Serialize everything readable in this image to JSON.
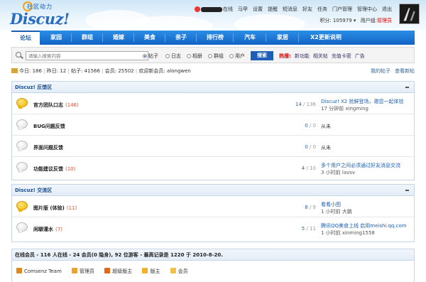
{
  "header": {
    "logo_sub": "社区动力",
    "logo_main": "Discuz!",
    "top_links": [
      "在线",
      "马甲",
      "设置",
      "提醒",
      "短消息",
      "好友",
      "任务",
      "门户管理",
      "管理中心",
      "退出"
    ],
    "points_label": "积分: 105979",
    "group_label": "用户组:",
    "group_value": "管理员"
  },
  "nav": {
    "items": [
      "论坛",
      "家园",
      "群组",
      "婚嫁",
      "美食",
      "亲子",
      "排行榜",
      "汽车",
      "家居",
      "X2更新说明"
    ],
    "active_index": 0
  },
  "search": {
    "placeholder": "请输入搜索内容",
    "options": [
      "帖子",
      "日志",
      "相册",
      "群组",
      "用户"
    ],
    "selected_index": 0,
    "button_label": "搜索",
    "hot_label": "热搜:",
    "hot_items": [
      "新功能",
      "相关帖",
      "充值卡密",
      "广告"
    ]
  },
  "stats": {
    "today": "今日: 186",
    "yesterday": "昨日: 12",
    "posts": "帖子: 41566",
    "members": "会员: 25502",
    "welcome": "欢迎新会员: alongwen",
    "my_posts": "我的帖子",
    "new_posts": "查看新帖"
  },
  "categories": [
    {
      "title": "Discuz! 反馈区",
      "forums": [
        {
          "name": "官方团队口志",
          "count": "(146)",
          "new": true,
          "threads": "14",
          "posts": "136",
          "last_title": "Discuz! X2 抢鲜登场，邀您一起体验",
          "last_meta": "17 分钟前 xingming"
        },
        {
          "name": "BUG问题反馈",
          "count": "",
          "new": false,
          "threads": "0",
          "posts": "0",
          "last_title": "从未",
          "last_meta": ""
        },
        {
          "name": "界面问题反馈",
          "count": "",
          "new": false,
          "threads": "0",
          "posts": "0",
          "last_title": "从未",
          "last_meta": ""
        },
        {
          "name": "功能建议反馈",
          "count": "(10)",
          "new": false,
          "threads": "4",
          "posts": "10",
          "last_title": "多个用户之间必须通过好友消息交流",
          "last_meta": "3 小时前 lavsv"
        }
      ]
    },
    {
      "title": "Discuz! 交流区",
      "forums": [
        {
          "name": "图片版 (体验)",
          "count": "(11)",
          "new": true,
          "threads": "8",
          "posts": "9",
          "last_title": "看看小图",
          "last_meta": "1 小时前 大鹏"
        },
        {
          "name": "闲聊灌水",
          "count": "(7)",
          "new": false,
          "threads": "5",
          "posts": "11",
          "last_title": "腾讯QQ美食上线 启用meishi.qq.com",
          "last_meta": "1 小时前 xinming1558"
        }
      ]
    }
  ],
  "online": {
    "summary": "在线会员 - 116 人在线 - 24 会员(0 隐身), 92 位游客 - 最高记录是 1220 于 2010-8-20.",
    "legend": [
      {
        "label": "Comsenz Team",
        "color": "#e08a1a"
      },
      {
        "label": "管理员",
        "color": "#f0a030"
      },
      {
        "label": "超级版主",
        "color": "#e06a1a"
      },
      {
        "label": "版主",
        "color": "#f3b12a"
      },
      {
        "label": "会员",
        "color": "#f2c04a"
      }
    ]
  }
}
